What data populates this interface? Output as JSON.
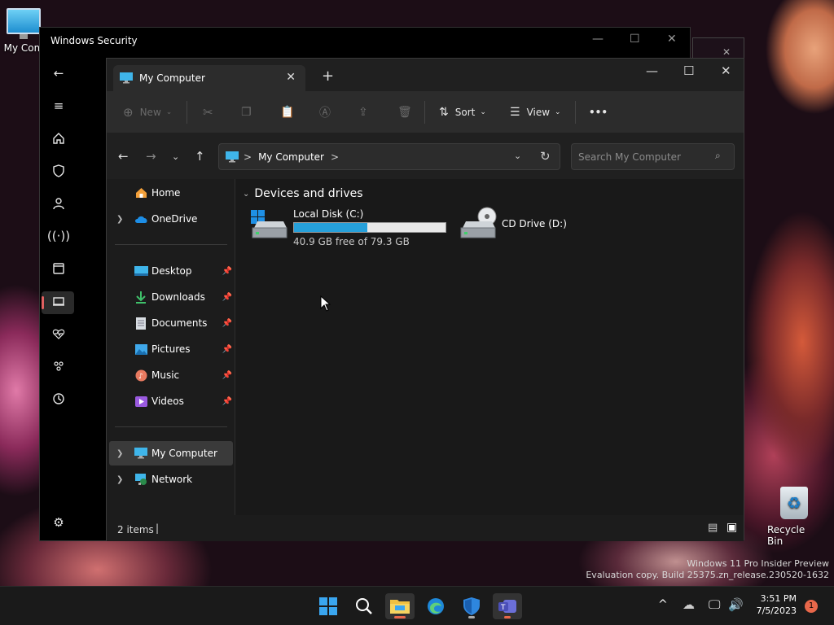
{
  "desktop": {
    "icons": [
      {
        "label": "My Com"
      },
      {
        "label": "Recycle Bin"
      }
    ],
    "watermark": {
      "line1": "Windows 11 Pro Insider Preview",
      "line2": "Evaluation copy. Build 25375.zn_release.230520-1632"
    }
  },
  "security_window": {
    "title": "Windows Security",
    "controls": {
      "minimize": "—",
      "maximize": "☐",
      "close": "✕"
    }
  },
  "explorer": {
    "tab_title": "My Computer",
    "tab_close": "✕",
    "new_tab": "+",
    "controls": {
      "minimize": "—",
      "maximize": "☐",
      "close": "✕"
    },
    "toolbar": {
      "new_label": "New",
      "sort_label": "Sort",
      "view_label": "View",
      "more_label": "•••"
    },
    "address": {
      "path": "My Computer",
      "sep": ">"
    },
    "search": {
      "placeholder": "Search My Computer"
    },
    "nav_pane": {
      "home": "Home",
      "onedrive": "OneDrive",
      "quick": [
        "Desktop",
        "Downloads",
        "Documents",
        "Pictures",
        "Music",
        "Videos"
      ],
      "this_pc": "My Computer",
      "network": "Network"
    },
    "section_title": "Devices and drives",
    "drives": [
      {
        "name": "Local Disk (C:)",
        "detail": "40.9 GB free of 79.3 GB",
        "used_fraction": 0.484
      },
      {
        "name": "CD Drive (D:)"
      }
    ],
    "status": {
      "items": "2 items"
    }
  },
  "taskbar": {
    "clock_time": "3:51 PM",
    "clock_date": "7/5/2023",
    "notification_count": "1"
  },
  "colors": {
    "accent": "#26a0da",
    "selection": "#3a3a3a",
    "badge": "#e8674a"
  }
}
